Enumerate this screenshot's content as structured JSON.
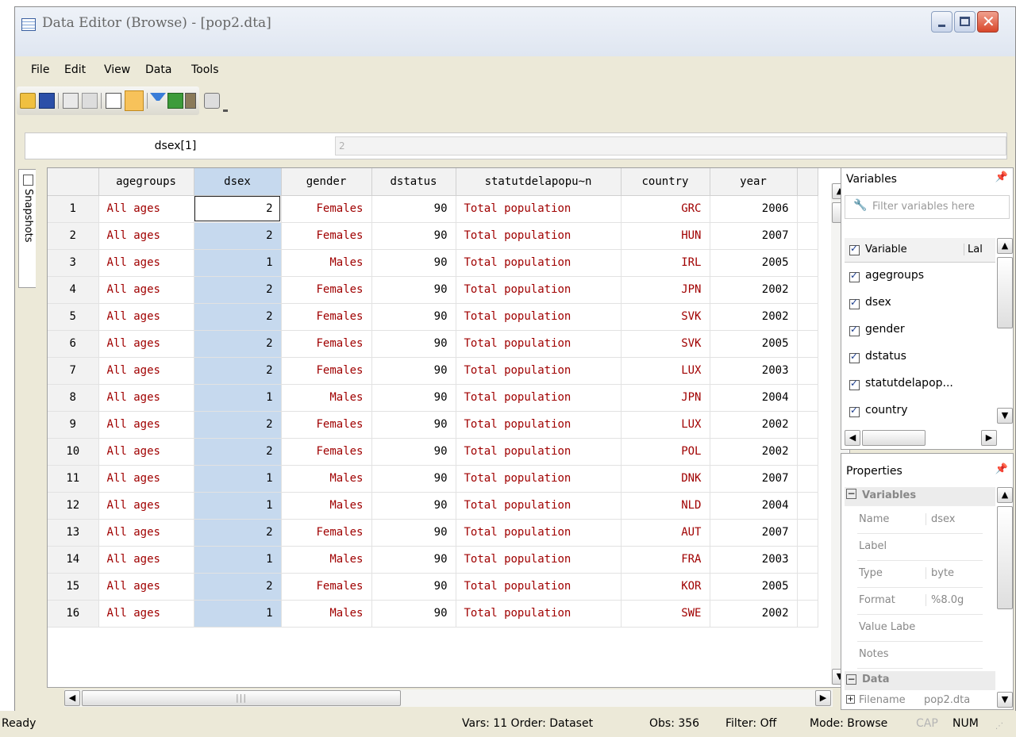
{
  "window": {
    "title": "Data Editor (Browse) - [pop2.dta]",
    "controls": {
      "minimize": "minimize-icon",
      "maximize": "maximize-icon",
      "close": "close-icon"
    }
  },
  "menu": [
    "File",
    "Edit",
    "View",
    "Data",
    "Tools"
  ],
  "toolbar": {
    "icons": [
      "open-icon",
      "save-icon",
      "copy-icon",
      "paste-icon",
      "edit-mode-icon",
      "browse-mode-icon",
      "filter-icon",
      "variables-manager-icon",
      "properties-icon",
      "snapshot-icon",
      "toolbar-options-icon"
    ]
  },
  "cellbar": {
    "name": "dsex[1]",
    "value": "2"
  },
  "snapshots": {
    "label": "Snapshots"
  },
  "grid": {
    "columns": [
      "agegroups",
      "dsex",
      "gender",
      "dstatus",
      "statutdelapopu~n",
      "country",
      "year"
    ],
    "rows": [
      [
        1,
        "All ages",
        "2",
        "Females",
        "90",
        "Total population",
        "GRC",
        "2006"
      ],
      [
        2,
        "All ages",
        "2",
        "Females",
        "90",
        "Total population",
        "HUN",
        "2007"
      ],
      [
        3,
        "All ages",
        "1",
        "Males",
        "90",
        "Total population",
        "IRL",
        "2005"
      ],
      [
        4,
        "All ages",
        "2",
        "Females",
        "90",
        "Total population",
        "JPN",
        "2002"
      ],
      [
        5,
        "All ages",
        "2",
        "Females",
        "90",
        "Total population",
        "SVK",
        "2002"
      ],
      [
        6,
        "All ages",
        "2",
        "Females",
        "90",
        "Total population",
        "SVK",
        "2005"
      ],
      [
        7,
        "All ages",
        "2",
        "Females",
        "90",
        "Total population",
        "LUX",
        "2003"
      ],
      [
        8,
        "All ages",
        "1",
        "Males",
        "90",
        "Total population",
        "JPN",
        "2004"
      ],
      [
        9,
        "All ages",
        "2",
        "Females",
        "90",
        "Total population",
        "LUX",
        "2002"
      ],
      [
        10,
        "All ages",
        "2",
        "Females",
        "90",
        "Total population",
        "POL",
        "2002"
      ],
      [
        11,
        "All ages",
        "1",
        "Males",
        "90",
        "Total population",
        "DNK",
        "2007"
      ],
      [
        12,
        "All ages",
        "1",
        "Males",
        "90",
        "Total population",
        "NLD",
        "2004"
      ],
      [
        13,
        "All ages",
        "2",
        "Females",
        "90",
        "Total population",
        "AUT",
        "2007"
      ],
      [
        14,
        "All ages",
        "1",
        "Males",
        "90",
        "Total population",
        "FRA",
        "2003"
      ],
      [
        15,
        "All ages",
        "2",
        "Females",
        "90",
        "Total population",
        "KOR",
        "2005"
      ],
      [
        16,
        "All ages",
        "1",
        "Males",
        "90",
        "Total population",
        "SWE",
        "2002"
      ]
    ]
  },
  "variables_pane": {
    "title": "Variables",
    "filter_placeholder": "Filter variables here",
    "header_variable": "Variable",
    "header_label": "Lal",
    "items": [
      "agegroups",
      "dsex",
      "gender",
      "dstatus",
      "statutdelapop...",
      "country"
    ]
  },
  "properties_pane": {
    "title": "Properties",
    "section_variables": "Variables",
    "rows": [
      {
        "key": "Name",
        "value": "dsex"
      },
      {
        "key": "Label",
        "value": ""
      },
      {
        "key": "Type",
        "value": "byte"
      },
      {
        "key": "Format",
        "value": "%8.0g"
      },
      {
        "key": "Value Labe",
        "value": ""
      },
      {
        "key": "Notes",
        "value": ""
      }
    ],
    "section_data": "Data",
    "filename_key": "Filename",
    "filename_value": "pop2.dta"
  },
  "status": {
    "ready": "Ready",
    "vars": "Vars: 11  Order: Dataset",
    "obs": "Obs: 356",
    "filter": "Filter: Off",
    "mode": "Mode: Browse",
    "cap": "CAP",
    "num": "NUM"
  },
  "colors": {
    "string_text": "#a00000",
    "selected_column": "#c6d9ee",
    "close_button": "#d8462a"
  }
}
